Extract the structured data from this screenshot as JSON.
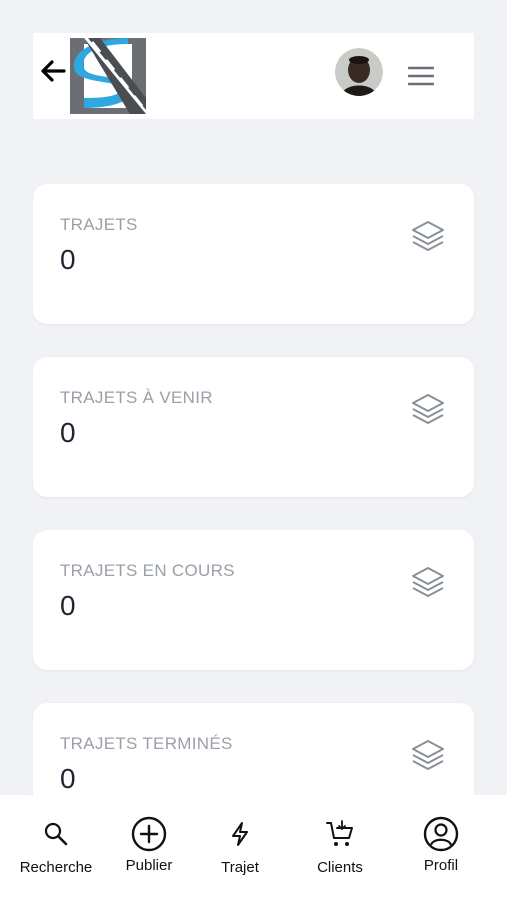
{
  "header": {
    "back_icon": "arrow-left-icon",
    "logo_icon": "road-s-logo",
    "avatar_icon": "user-avatar",
    "menu_icon": "hamburger-menu-icon"
  },
  "cards": [
    {
      "title": "TRAJETS",
      "value": "0",
      "icon": "layers-icon"
    },
    {
      "title": "TRAJETS À VENIR",
      "value": "0",
      "icon": "layers-icon"
    },
    {
      "title": "TRAJETS EN COURS",
      "value": "0",
      "icon": "layers-icon"
    },
    {
      "title": "TRAJETS TERMINÉS",
      "value": "0",
      "icon": "layers-icon"
    }
  ],
  "bottom_nav": [
    {
      "label": "Recherche",
      "icon": "search-icon"
    },
    {
      "label": "Publier",
      "icon": "plus-circle-icon"
    },
    {
      "label": "Trajet",
      "icon": "lightning-icon"
    },
    {
      "label": "Clients",
      "icon": "cart-icon"
    },
    {
      "label": "Profil",
      "icon": "user-circle-icon"
    }
  ],
  "colors": {
    "background": "#f0f2f5",
    "card": "#ffffff",
    "card_title": "#9aa0a8",
    "card_value": "#1f2533",
    "logo_blue": "#2fa8e0",
    "logo_gray": "#6b6f73"
  }
}
